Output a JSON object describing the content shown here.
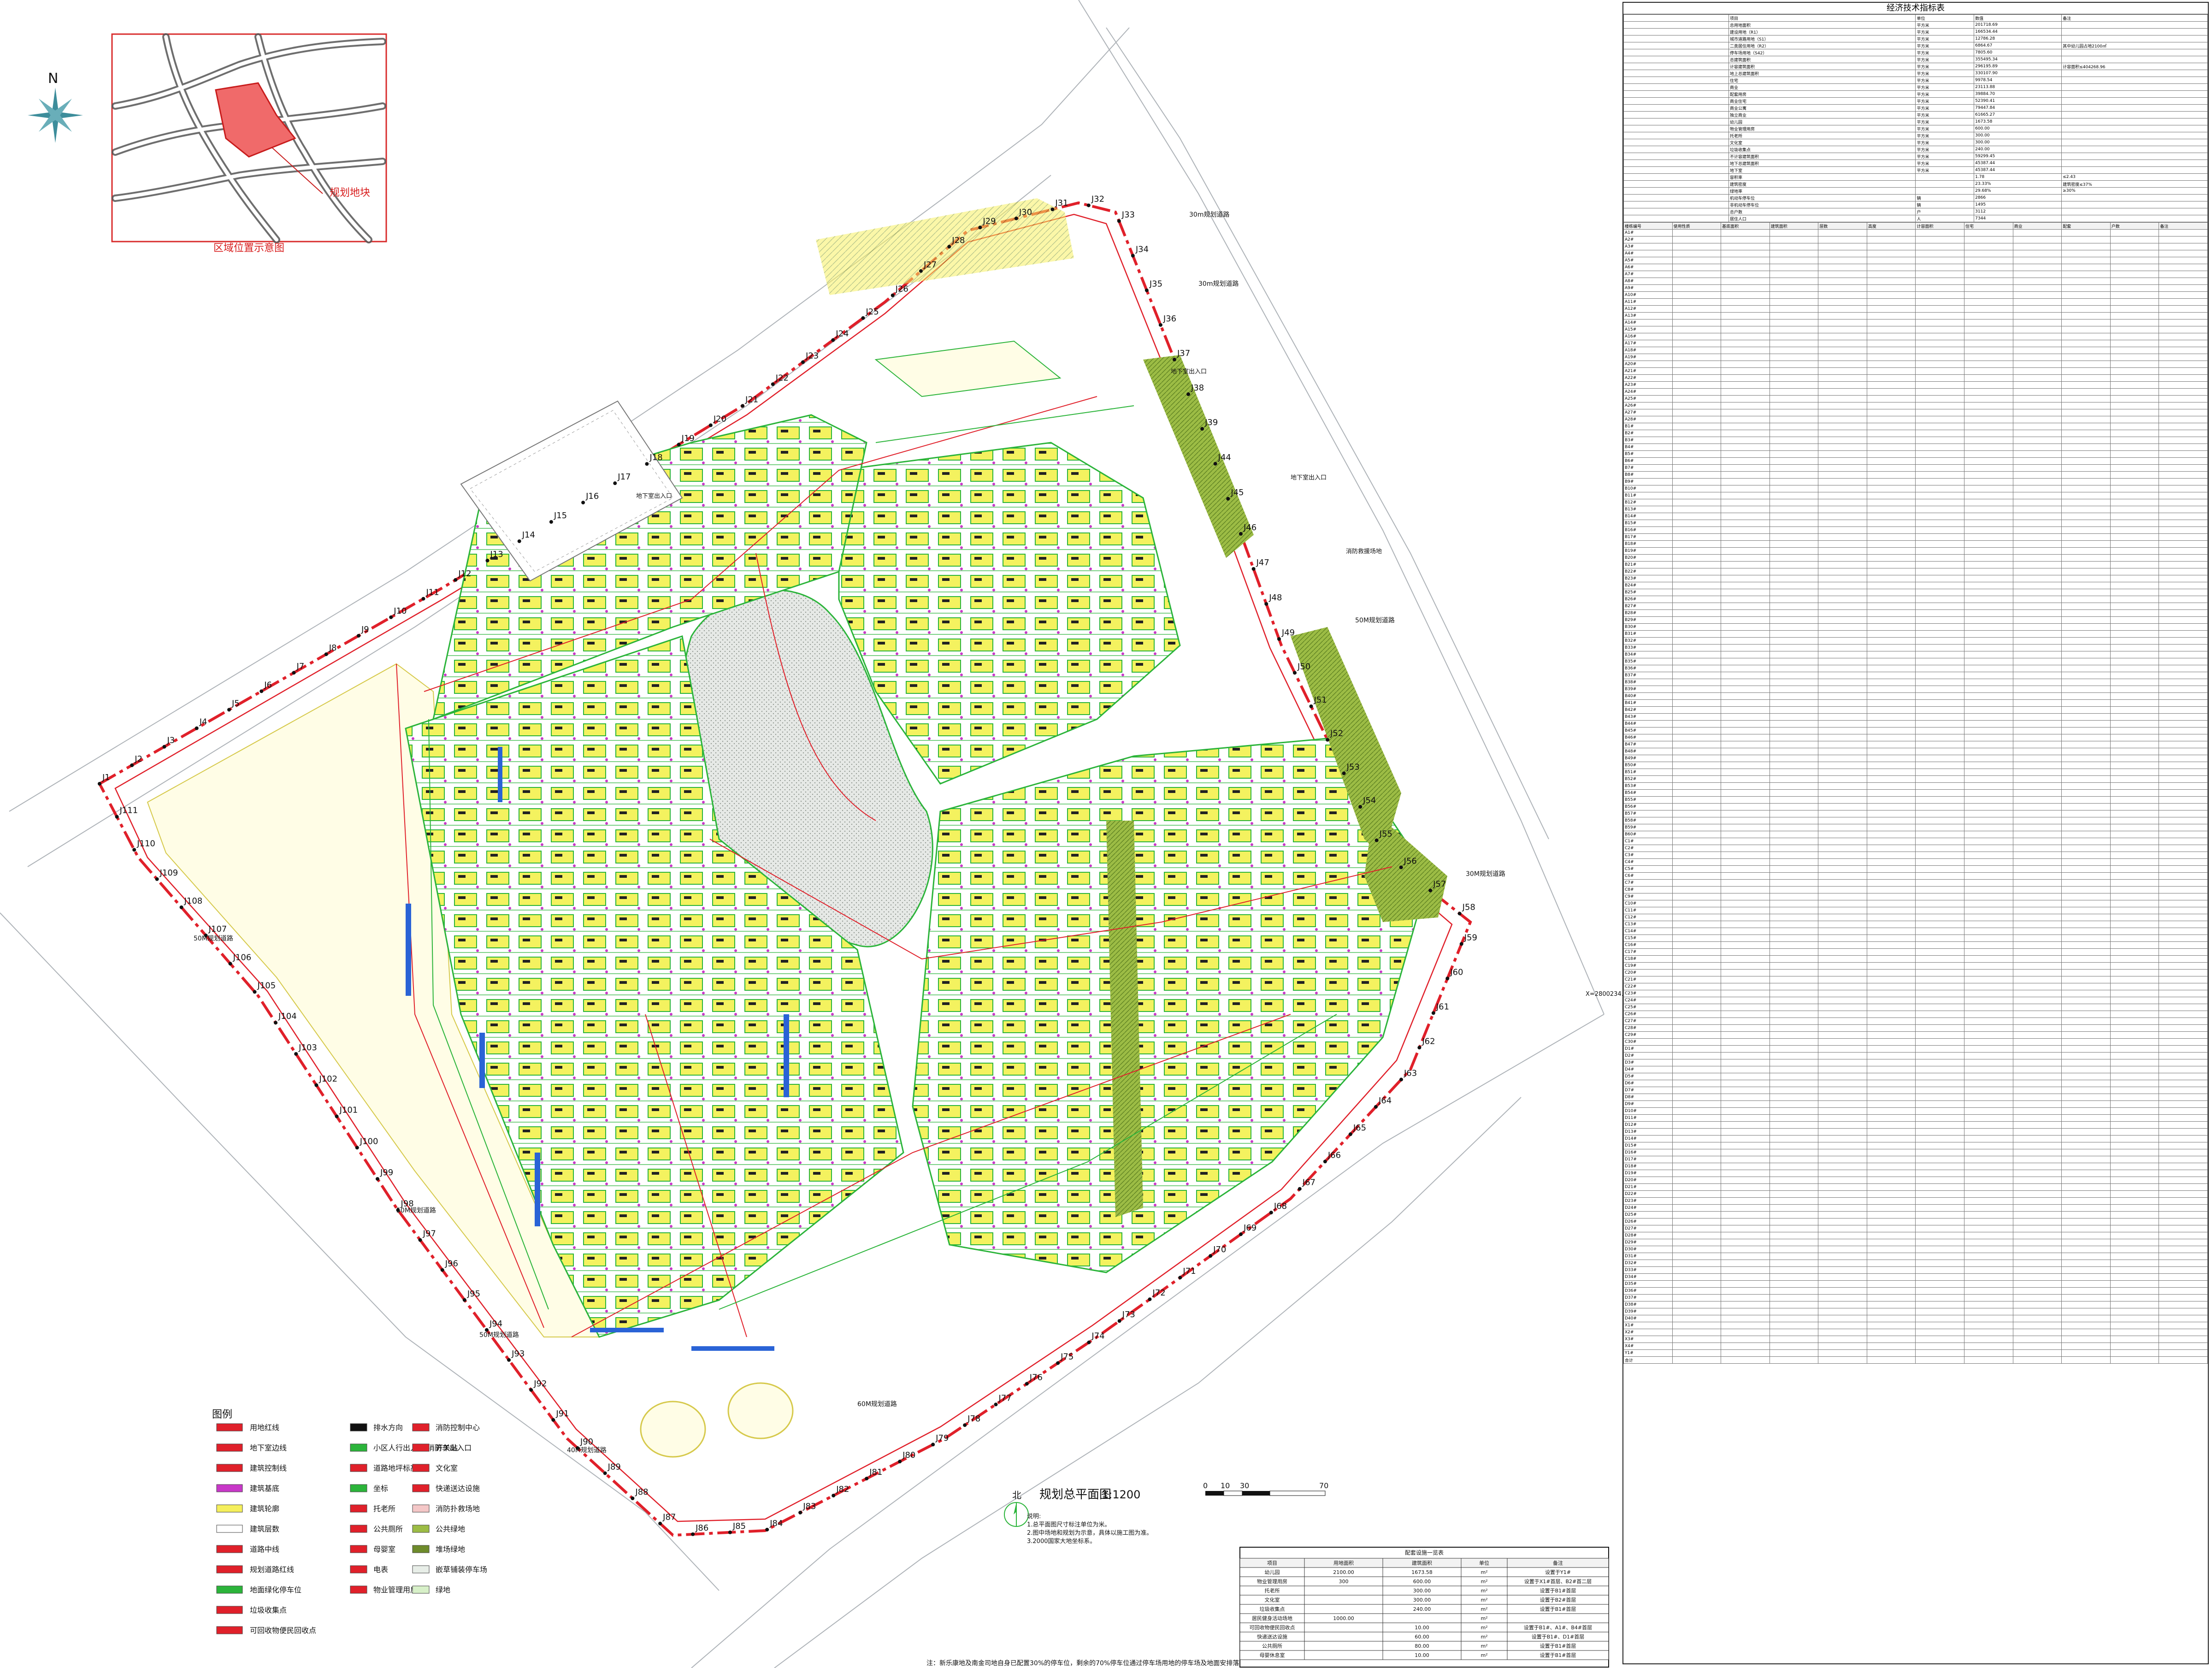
{
  "site_plan": {
    "title": "规划总平面图",
    "scale": "1:1200",
    "north_label": "北",
    "scale_bar_ticks": [
      "0",
      "10",
      "30",
      "70"
    ],
    "coordinate_label": "X=2800234.909",
    "notes": [
      "说明:",
      "1.总平面图尺寸标注单位为米。",
      "2.图中场地和规划为示意，具体以施工图为准。",
      "3.2000国家大地坐标系。"
    ],
    "parking_note": "注：新乐康地及南金司地自身已配置30%的停车位，剩余的70%停车位通过停车场用地的停车场及地面安排落实。",
    "point_labels": [
      "J1",
      "J2",
      "J3",
      "J4",
      "J5",
      "J6",
      "J7",
      "J8",
      "J9",
      "J10",
      "J11",
      "J12",
      "J13",
      "J14",
      "J15",
      "J16",
      "J17",
      "J18",
      "J19",
      "J20",
      "J21",
      "J22",
      "J23",
      "J24",
      "J25",
      "J26",
      "J27",
      "J28",
      "J29",
      "J30",
      "J31",
      "J32",
      "J33",
      "J34",
      "J35",
      "J36",
      "J37",
      "J38",
      "J39",
      "J44",
      "J45",
      "J46",
      "J47",
      "J48",
      "J49",
      "J50",
      "J51",
      "J52",
      "J53",
      "J54",
      "J55",
      "J56",
      "J57",
      "J58",
      "J59",
      "J60",
      "J61",
      "J62",
      "J63",
      "J64",
      "J65",
      "J66",
      "J67",
      "J68",
      "J69",
      "J70",
      "J71",
      "J72",
      "J73",
      "J74",
      "J75",
      "J76",
      "J77",
      "J78",
      "J79",
      "J80",
      "J81",
      "J82",
      "J83",
      "J84",
      "J85",
      "J86",
      "J87",
      "J88",
      "J89",
      "J90",
      "J91",
      "J92",
      "J93",
      "J94",
      "J95",
      "J96",
      "J97",
      "J98",
      "J99",
      "J100",
      "J101",
      "J102",
      "J103",
      "J104",
      "J105",
      "J106",
      "J107",
      "J108",
      "J109",
      "J110",
      "J111"
    ],
    "road_labels": [
      "30m规划道路",
      "30m规划道路",
      "60M规划道路",
      "50M规划道路",
      "50M规划道路",
      "50M规划道路",
      "40M规划道路",
      "50M规划道路",
      "30M规划道路"
    ],
    "callouts": [
      "地下室出入口",
      "地下室出入口",
      "地下室出入口",
      "消防救援场地"
    ]
  },
  "location_map": {
    "title": "区域位置示意图",
    "site_label": "规划地块",
    "compass_label": "N"
  },
  "legend": {
    "title": "图例",
    "items": [
      {
        "label": "用地红线",
        "col": 0
      },
      {
        "label": "地下室边线",
        "col": 0
      },
      {
        "label": "建筑控制线",
        "col": 0
      },
      {
        "label": "建筑基底",
        "col": 0
      },
      {
        "label": "建筑轮廓",
        "col": 0
      },
      {
        "label": "建筑层数",
        "col": 0
      },
      {
        "label": "道路中线",
        "col": 0
      },
      {
        "label": "规划道路红线",
        "col": 0
      },
      {
        "label": "地面绿化停车位",
        "col": 0
      },
      {
        "label": "垃圾收集点",
        "col": 0
      },
      {
        "label": "可回收物便民回收点",
        "col": 0
      },
      {
        "label": "排水方向",
        "col": 1
      },
      {
        "label": "小区人行出入口 消防车出入口",
        "col": 1
      },
      {
        "label": "道路地坪标高",
        "col": 1
      },
      {
        "label": "坐标",
        "col": 1
      },
      {
        "label": "托老所",
        "col": 1
      },
      {
        "label": "公共厕所",
        "col": 1
      },
      {
        "label": "母婴室",
        "col": 1
      },
      {
        "label": "电表",
        "col": 1
      },
      {
        "label": "物业管理用房",
        "col": 1
      },
      {
        "label": "消防控制中心",
        "col": 2
      },
      {
        "label": "开关站",
        "col": 2
      },
      {
        "label": "文化室",
        "col": 2
      },
      {
        "label": "快递送达设施",
        "col": 2
      },
      {
        "label": "消防扑救场地",
        "col": 2
      },
      {
        "label": "公共绿地",
        "col": 2
      },
      {
        "label": "堆场绿地",
        "col": 2
      },
      {
        "label": "嵌草铺装停车场",
        "col": 2
      },
      {
        "label": "绿地",
        "col": 2
      }
    ]
  },
  "facility_table": {
    "title": "配套设施一览表",
    "headers": [
      "项目",
      "用地面积",
      "建筑面积",
      "单位",
      "备注"
    ],
    "rows": [
      [
        "幼儿园",
        "2100.00",
        "1673.58",
        "m²",
        "设置于Y1#"
      ],
      [
        "物业管理用房",
        "300",
        "600.00",
        "m²",
        "设置于X1#首层、B2#首二层"
      ],
      [
        "托老所",
        "",
        "300.00",
        "m²",
        "设置于B1#首层"
      ],
      [
        "文化室",
        "",
        "300.00",
        "m²",
        "设置于B2#首层"
      ],
      [
        "垃圾收集点",
        "",
        "240.00",
        "m²",
        "设置于B1#首层"
      ],
      [
        "居民健身活动场地",
        "1000.00",
        "",
        "m²",
        ""
      ],
      [
        "可回收物便民回收点",
        "",
        "10.00",
        "m²",
        "设置于B1#、A1#、B4#首层"
      ],
      [
        "快递送达设施",
        "",
        "60.00",
        "m²",
        "设置于B1#、D1#首层"
      ],
      [
        "公共厕所",
        "",
        "80.00",
        "m²",
        "设置于B1#首层"
      ],
      [
        "母婴休息室",
        "",
        "10.00",
        "m²",
        "设置于B1#首层"
      ]
    ]
  },
  "econ_table": {
    "title": "经济技术指标表",
    "head_cols": [
      "项目",
      "单位",
      "数值",
      "备注"
    ],
    "top_rows": [
      [
        "总用地面积",
        "平方米",
        "201718.69",
        ""
      ],
      [
        "建设用地（R1）",
        "平方米",
        "166534.44",
        ""
      ],
      [
        "城市道路用地（S1）",
        "平方米",
        "12786.28",
        ""
      ],
      [
        "二类居住用地（R2）",
        "平方米",
        "6864.67",
        "其中幼儿园占地2100㎡"
      ],
      [
        "停车场用地（S42）",
        "平方米",
        "7805.60",
        ""
      ],
      [
        "总建筑面积",
        "平方米",
        "355495.34",
        ""
      ],
      [
        "计容建筑面积",
        "平方米",
        "296195.89",
        "计容面积≤404268.96"
      ],
      [
        "地上总建筑面积",
        "平方米",
        "330107.90",
        ""
      ],
      [
        "住宅",
        "平方米",
        "9978.54",
        ""
      ],
      [
        "商业",
        "平方米",
        "23113.88",
        ""
      ],
      [
        "配套用房",
        "平方米",
        "39884.70",
        ""
      ],
      [
        "商业住宅",
        "平方米",
        "52390.41",
        ""
      ],
      [
        "商业公寓",
        "平方米",
        "79447.84",
        ""
      ],
      [
        "独立商业",
        "平方米",
        "61665.27",
        ""
      ],
      [
        "幼儿园",
        "平方米",
        "1673.58",
        ""
      ],
      [
        "物业管理用房",
        "平方米",
        "600.00",
        ""
      ],
      [
        "托老所",
        "平方米",
        "300.00",
        ""
      ],
      [
        "文化室",
        "平方米",
        "300.00",
        ""
      ],
      [
        "垃圾收集点",
        "平方米",
        "240.00",
        ""
      ],
      [
        "不计容建筑面积",
        "平方米",
        "59299.45",
        ""
      ],
      [
        "地下总建筑面积",
        "平方米",
        "45387.44",
        ""
      ],
      [
        "地下室",
        "平方米",
        "45387.44",
        ""
      ],
      [
        "容积率",
        "",
        "1.78",
        "≤2.43"
      ],
      [
        "建筑密度",
        "",
        "23.33%",
        "建筑密度≤37%"
      ],
      [
        "绿地率",
        "",
        "29.68%",
        "≥30%"
      ],
      [
        "机动车停车位",
        "辆",
        "2866",
        ""
      ],
      [
        "非机动车停车位",
        "辆",
        "1495",
        ""
      ],
      [
        "总户数",
        "户",
        "3112",
        ""
      ],
      [
        "居住人口",
        "人",
        "7344",
        ""
      ]
    ],
    "detail_header": [
      "楼栋编号",
      "使用性质",
      "基底面积",
      "建筑面积",
      "层数",
      "高度",
      "计容面积",
      "住宅",
      "商业",
      "配套",
      "户数",
      "备注"
    ],
    "building_ids": [
      "A1#",
      "A2#",
      "A3#",
      "A4#",
      "A5#",
      "A6#",
      "A7#",
      "A8#",
      "A9#",
      "A10#",
      "A11#",
      "A12#",
      "A13#",
      "A14#",
      "A15#",
      "A16#",
      "A17#",
      "A18#",
      "A19#",
      "A20#",
      "A21#",
      "A22#",
      "A23#",
      "A24#",
      "A25#",
      "A26#",
      "A27#",
      "A28#",
      "B1#",
      "B2#",
      "B3#",
      "B4#",
      "B5#",
      "B6#",
      "B7#",
      "B8#",
      "B9#",
      "B10#",
      "B11#",
      "B12#",
      "B13#",
      "B14#",
      "B15#",
      "B16#",
      "B17#",
      "B18#",
      "B19#",
      "B20#",
      "B21#",
      "B22#",
      "B23#",
      "B24#",
      "B25#",
      "B26#",
      "B27#",
      "B28#",
      "B29#",
      "B30#",
      "B31#",
      "B32#",
      "B33#",
      "B34#",
      "B35#",
      "B36#",
      "B37#",
      "B38#",
      "B39#",
      "B40#",
      "B41#",
      "B42#",
      "B43#",
      "B44#",
      "B45#",
      "B46#",
      "B47#",
      "B48#",
      "B49#",
      "B50#",
      "B51#",
      "B52#",
      "B53#",
      "B54#",
      "B55#",
      "B56#",
      "B57#",
      "B58#",
      "B59#",
      "B60#",
      "C1#",
      "C2#",
      "C3#",
      "C4#",
      "C5#",
      "C6#",
      "C7#",
      "C8#",
      "C9#",
      "C10#",
      "C11#",
      "C12#",
      "C13#",
      "C14#",
      "C15#",
      "C16#",
      "C17#",
      "C18#",
      "C19#",
      "C20#",
      "C21#",
      "C22#",
      "C23#",
      "C24#",
      "C25#",
      "C26#",
      "C27#",
      "C28#",
      "C29#",
      "C30#",
      "D1#",
      "D2#",
      "D3#",
      "D4#",
      "D5#",
      "D6#",
      "D7#",
      "D8#",
      "D9#",
      "D10#",
      "D11#",
      "D12#",
      "D13#",
      "D14#",
      "D15#",
      "D16#",
      "D17#",
      "D18#",
      "D19#",
      "D20#",
      "D21#",
      "D22#",
      "D23#",
      "D24#",
      "D25#",
      "D26#",
      "D27#",
      "D28#",
      "D29#",
      "D30#",
      "D31#",
      "D32#",
      "D33#",
      "D34#",
      "D35#",
      "D36#",
      "D37#",
      "D38#",
      "D39#",
      "D40#",
      "X1#",
      "X2#",
      "X3#",
      "X4#",
      "Y1#",
      "合计"
    ]
  },
  "colors": {
    "redline": "#e0202a",
    "green": "#2bb43a",
    "yellow_fill": "#f5ef5c",
    "dark_green": "#8bb23d",
    "gray_dots": "#c8ccc8",
    "magenta": "#c838c8",
    "blue": "#2a63d6"
  }
}
